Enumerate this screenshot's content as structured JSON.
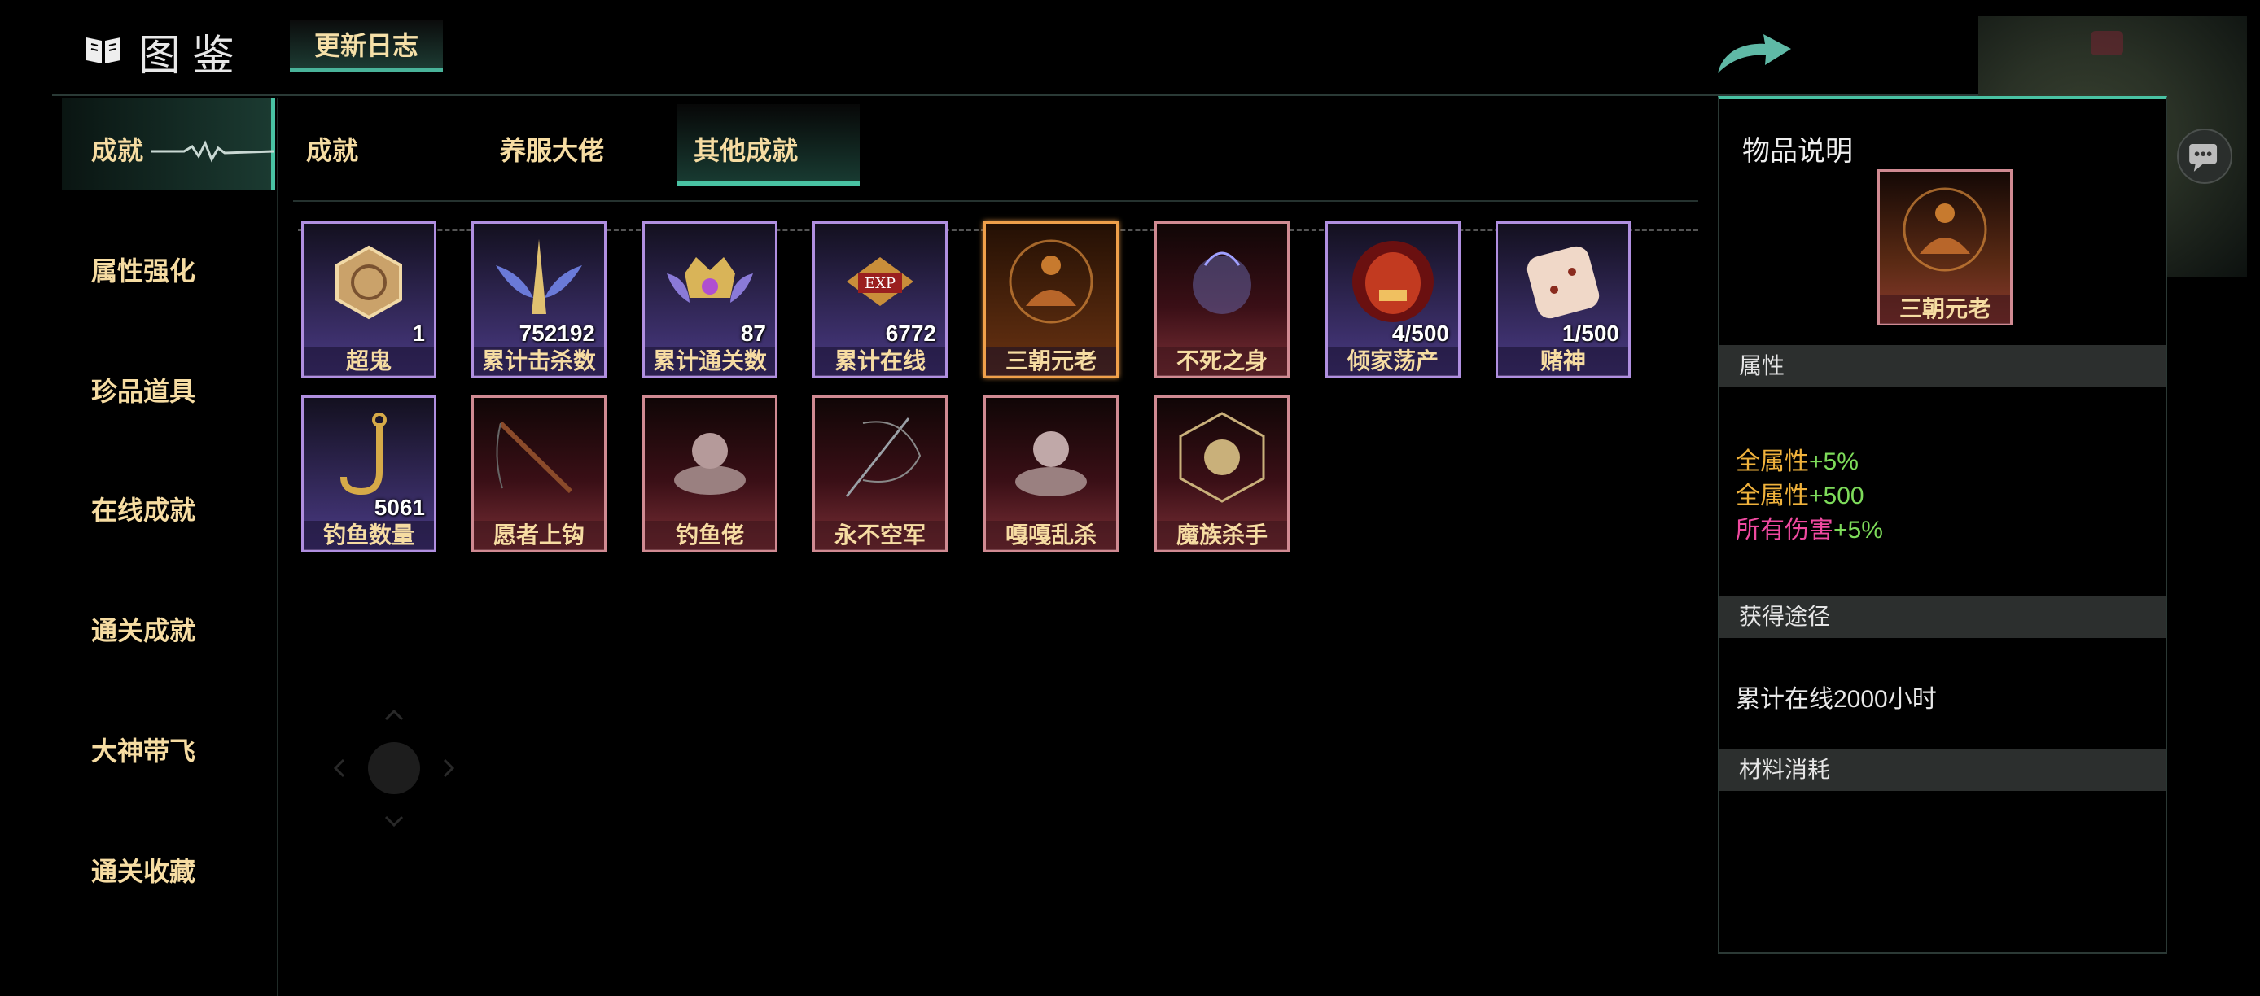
{
  "header": {
    "title": "图鉴",
    "changelog_tab": "更新日志"
  },
  "sidebar": {
    "items": [
      {
        "label": "成就",
        "active": true
      },
      {
        "label": "属性强化"
      },
      {
        "label": "珍品道具"
      },
      {
        "label": "在线成就"
      },
      {
        "label": "通关成就"
      },
      {
        "label": "大神带飞"
      },
      {
        "label": "通关收藏"
      }
    ]
  },
  "subtabs": [
    {
      "label": "成就"
    },
    {
      "label": "养服大佬"
    },
    {
      "label": "其他成就",
      "active": true
    }
  ],
  "cards": [
    {
      "name": "超鬼",
      "count": "1",
      "icon": "hexagon-emblem-icon",
      "theme": "purple"
    },
    {
      "name": "累计击杀数",
      "count": "752192",
      "icon": "winged-sword-icon",
      "theme": "purple"
    },
    {
      "name": "累计通关数",
      "count": "87",
      "icon": "crown-crest-icon",
      "theme": "purple"
    },
    {
      "name": "累计在线",
      "count": "6772",
      "icon": "exp-badge-icon",
      "theme": "purple"
    },
    {
      "name": "三朝元老",
      "count": "",
      "icon": "meditating-sage-icon",
      "theme": "orange",
      "selected": true
    },
    {
      "name": "不死之身",
      "count": "",
      "icon": "spirit-aura-icon",
      "theme": "red"
    },
    {
      "name": "倾家荡产",
      "count": "4/500",
      "icon": "demon-face-icon",
      "theme": "purple"
    },
    {
      "name": "赌神",
      "count": "1/500",
      "icon": "dice-icon",
      "theme": "purple"
    },
    {
      "name": "钓鱼数量",
      "count": "5061",
      "icon": "fish-hook-icon",
      "theme": "purple"
    },
    {
      "name": "愿者上钩",
      "count": "",
      "icon": "fishing-rod-icon",
      "theme": "red"
    },
    {
      "name": "钓鱼佬",
      "count": "",
      "icon": "cloud-fisher-icon",
      "theme": "red"
    },
    {
      "name": "永不空军",
      "count": "",
      "icon": "fishing-line-icon",
      "theme": "red"
    },
    {
      "name": "嘎嘎乱杀",
      "count": "",
      "icon": "cloud-warrior-icon",
      "theme": "red"
    },
    {
      "name": "魔族杀手",
      "count": "",
      "icon": "taiji-seal-icon",
      "theme": "red"
    }
  ],
  "panel": {
    "title": "物品说明",
    "item_name": "三朝元老",
    "attributes_header": "属性",
    "attributes": [
      {
        "name": "全属性",
        "value": "+5%"
      },
      {
        "name": "全属性",
        "value": "+500"
      },
      {
        "name": "所有伤害",
        "value": "+5%"
      }
    ],
    "source_header": "获得途径",
    "source_text": "累计在线2000小时",
    "materials_header": "材料消耗"
  },
  "colors": {
    "accent": "#49c2a3",
    "label_gold": "#f6dca2",
    "stat_gold": "#f0b23c",
    "stat_green": "#7ddb5a",
    "stat_pink": "#f04aa0"
  }
}
